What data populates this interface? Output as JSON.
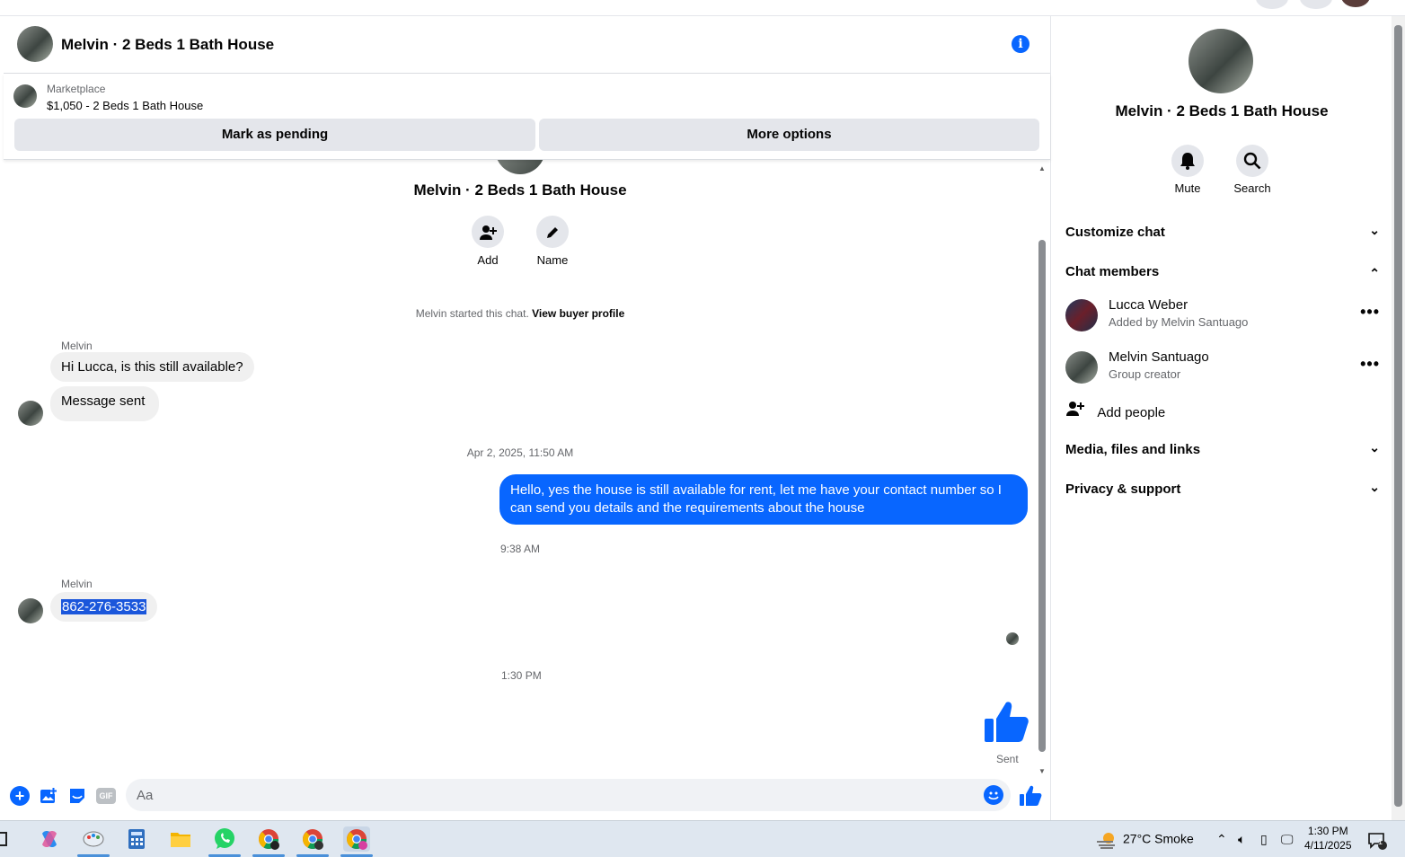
{
  "chat": {
    "title": "Melvin · 2 Beds 1 Bath House",
    "marketplace_label": "Marketplace",
    "listing": "$1,050 - 2 Beds 1 Bath House",
    "mark_pending": "Mark as pending",
    "more_options": "More options"
  },
  "intro": {
    "name": "Melvin · 2 Beds 1 Bath House",
    "add_label": "Add",
    "name_label": "Name",
    "started_text": "Melvin started this chat.",
    "view_profile": "View buyer profile"
  },
  "messages": {
    "sender1": "Melvin",
    "msg1": "Hi Lucca, is this still available?",
    "msg2": "Message sent",
    "time1": "Apr 2, 2025, 11:50 AM",
    "out1": "Hello, yes the house is still available for rent, let me have your contact number so I can send you details and the requirements about the house",
    "time2": "9:38 AM",
    "sender2": "Melvin",
    "phone": "862-276-3533",
    "time3": "1:30 PM",
    "sent": "Sent"
  },
  "composer": {
    "placeholder": "Aa",
    "gif": "GIF"
  },
  "side": {
    "title": "Melvin · 2 Beds 1 Bath House",
    "mute": "Mute",
    "search": "Search",
    "customize": "Customize chat",
    "members_header": "Chat members",
    "members": [
      {
        "name": "Lucca Weber",
        "sub": "Added by Melvin Santuago"
      },
      {
        "name": "Melvin Santuago",
        "sub": "Group creator"
      }
    ],
    "add_people": "Add people",
    "media": "Media, files and links",
    "privacy": "Privacy & support"
  },
  "taskbar": {
    "weather": "27°C  Smoke",
    "time": "1:30 PM",
    "date": "4/11/2025",
    "notif_count": "1"
  },
  "colors": {
    "accent": "#0866ff",
    "bubble_in": "#f0f0f0"
  }
}
